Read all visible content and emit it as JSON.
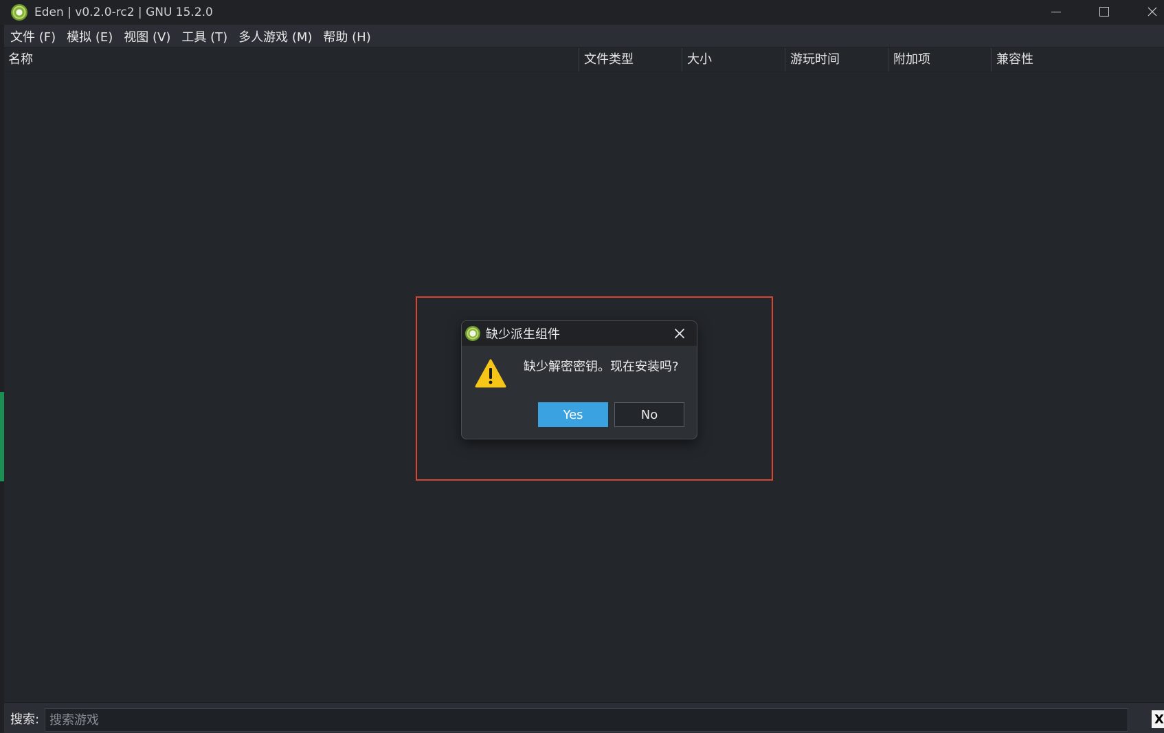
{
  "window": {
    "title": "Eden | v0.2.0-rc2 | GNU 15.2.0",
    "logo_icon": "eden-logo-icon"
  },
  "menu": [
    {
      "label": "文件 (F)"
    },
    {
      "label": "模拟 (E)"
    },
    {
      "label": "视图 (V)"
    },
    {
      "label": "工具 (T)"
    },
    {
      "label": "多人游戏 (M)"
    },
    {
      "label": "帮助 (H)"
    }
  ],
  "table": {
    "columns": [
      {
        "label": "名称"
      },
      {
        "label": "文件类型"
      },
      {
        "label": "大小"
      },
      {
        "label": "游玩时间"
      },
      {
        "label": "附加项"
      },
      {
        "label": "兼容性"
      }
    ]
  },
  "search": {
    "label": "搜索:",
    "placeholder": "搜索游戏",
    "clear_label": "X"
  },
  "dialog": {
    "title": "缺少派生组件",
    "message": "缺少解密密钥。现在安装吗?",
    "icon": "warning-icon",
    "yes_label": "Yes",
    "no_label": "No"
  },
  "colors": {
    "background": "#23272c",
    "accent": "#3aa2e0",
    "highlight_border": "#d84530",
    "warning": "#f5c518"
  }
}
